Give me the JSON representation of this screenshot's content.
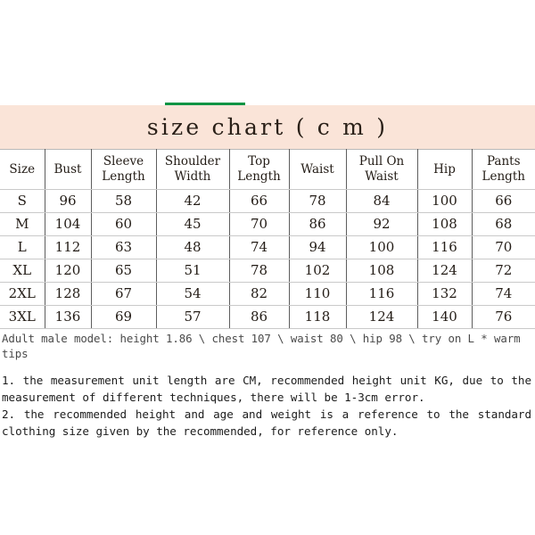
{
  "accent": {
    "green_rule": "#0b9444",
    "band_background": "#fae4d8",
    "page_background": "#ffffff"
  },
  "header": {
    "title": "size chart ( c m )"
  },
  "table": {
    "columns": [
      {
        "label": "Size",
        "line1": "Size",
        "line2": ""
      },
      {
        "label": "Bust",
        "line1": "Bust",
        "line2": ""
      },
      {
        "label": "Sleeve Length",
        "line1": "Sleeve",
        "line2": "Length"
      },
      {
        "label": "Shoulder Width",
        "line1": "Shoulder",
        "line2": "Width"
      },
      {
        "label": "Top Length",
        "line1": "Top",
        "line2": "Length"
      },
      {
        "label": "Waist",
        "line1": "Waist",
        "line2": ""
      },
      {
        "label": "Pull On Waist",
        "line1": "Pull On",
        "line2": "Waist"
      },
      {
        "label": "Hip",
        "line1": "Hip",
        "line2": ""
      },
      {
        "label": "Pants Length",
        "line1": "Pants",
        "line2": "Length"
      }
    ],
    "rows": [
      {
        "size": "S",
        "bust": "96",
        "sleeve_length": "58",
        "shoulder_width": "42",
        "top_length": "66",
        "waist": "78",
        "pull_on_waist": "84",
        "hip": "100",
        "pants_length": "66"
      },
      {
        "size": "M",
        "bust": "104",
        "sleeve_length": "60",
        "shoulder_width": "45",
        "top_length": "70",
        "waist": "86",
        "pull_on_waist": "92",
        "hip": "108",
        "pants_length": "68"
      },
      {
        "size": "L",
        "bust": "112",
        "sleeve_length": "63",
        "shoulder_width": "48",
        "top_length": "74",
        "waist": "94",
        "pull_on_waist": "100",
        "hip": "116",
        "pants_length": "70"
      },
      {
        "size": "XL",
        "bust": "120",
        "sleeve_length": "65",
        "shoulder_width": "51",
        "top_length": "78",
        "waist": "102",
        "pull_on_waist": "108",
        "hip": "124",
        "pants_length": "72"
      },
      {
        "size": "2XL",
        "bust": "128",
        "sleeve_length": "67",
        "shoulder_width": "54",
        "top_length": "82",
        "waist": "110",
        "pull_on_waist": "116",
        "hip": "132",
        "pants_length": "74"
      },
      {
        "size": "3XL",
        "bust": "136",
        "sleeve_length": "69",
        "shoulder_width": "57",
        "top_length": "86",
        "waist": "118",
        "pull_on_waist": "124",
        "hip": "140",
        "pants_length": "76"
      }
    ]
  },
  "model_note": "Adult male model: height 1.86 \\ chest 107 \\ waist 80 \\ hip 98 \\ try on L * warm tips",
  "notes": [
    "1. the measurement unit length are CM, recommended height unit KG, due to the measurement of different techniques, there will be 1-3cm error.",
    "2. the recommended height and age and weight is a reference to the standard clothing size given by the recommended, for reference only."
  ]
}
